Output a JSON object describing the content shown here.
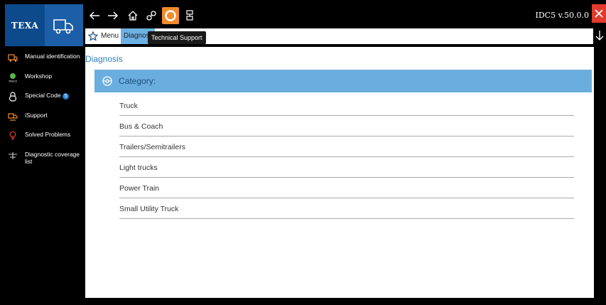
{
  "app": {
    "brand": "TEXA",
    "version": "IDC5 v.50.0.0"
  },
  "toolbar": {
    "back_icon": "arrow-left-icon",
    "forward_icon": "arrow-right-icon",
    "home_icon": "home-icon",
    "connect_icon": "link-icon",
    "support_icon": "lifebuoy-icon",
    "device_icon": "device-icon",
    "support_color": "#f28b2a",
    "close_color": "#e23b2e"
  },
  "breadcrumb": {
    "items": [
      "Menu",
      "Diagnosis"
    ],
    "tooltip": "Technical Support"
  },
  "sidebar": {
    "items": [
      {
        "label": "Manual identification",
        "icon": "car-icon"
      },
      {
        "label": "Workshop",
        "icon": "truck-workshop-icon"
      },
      {
        "label": "Special Code",
        "icon": "lock-icon",
        "badge": "5"
      },
      {
        "label": "iSupport",
        "icon": "isupport-icon"
      },
      {
        "label": "Solved Problems",
        "icon": "lightbulb-icon"
      },
      {
        "label": "Diagnostic coverage list",
        "icon": "coverage-icon"
      }
    ]
  },
  "main": {
    "title": "Diagnosis",
    "category_label": "Category:",
    "categories": [
      "Truck",
      "Bus & Coach",
      "Trailers/Semitrailers",
      "Light trucks",
      "Power Train",
      "Small Utility Truck"
    ]
  },
  "colors": {
    "accent": "#2d7fc1",
    "header_bg": "#6aaee0",
    "sidebar_icon": "#f28b2a"
  }
}
